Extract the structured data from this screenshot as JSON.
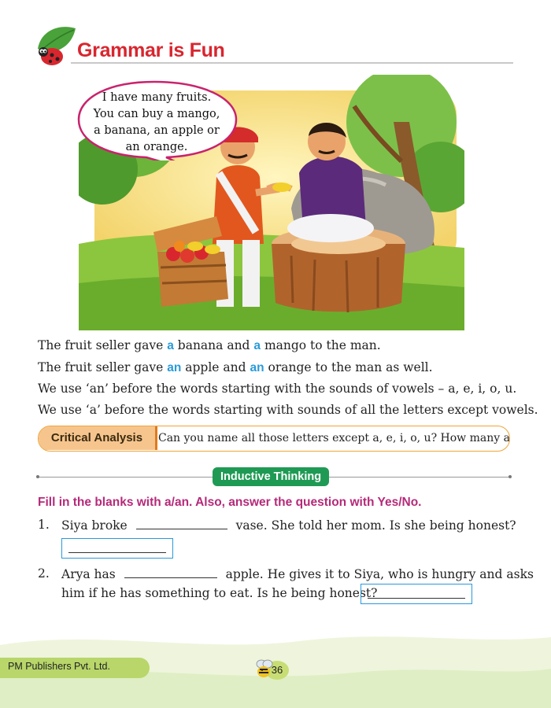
{
  "header": {
    "title": "Grammar is Fun",
    "icon": "ladybug-leaf-icon"
  },
  "speech_bubble": {
    "lines": [
      "I have many fruits.",
      "You can buy a mango,",
      "a banana, an apple or",
      "an orange."
    ]
  },
  "sentences": {
    "s1": {
      "a": "The fruit seller gave ",
      "hl1": "a",
      "b": " banana and ",
      "hl2": "a",
      "c": " mango to the man."
    },
    "s2": {
      "a": "The fruit seller gave ",
      "hl1": "an",
      "b": " apple and ",
      "hl2": "an",
      "c": " orange to the man as well."
    },
    "s3": "We use ‘an’ before the words starting with the sounds of vowels – a, e, i, o, u.",
    "s4": "We use ‘a’ before the words starting with sounds of all the letters except vowels."
  },
  "critical_analysis": {
    "label": "Critical Analysis",
    "question": "Can you name all those letters except a, e, i, o, u? How many are they?"
  },
  "inductive": {
    "badge": "Inductive Thinking",
    "instruction": "Fill in the blanks with a/an. Also, answer the question with Yes/No.",
    "q1": {
      "num": "1.",
      "a": "Siya broke",
      "b": "vase. She told her mom. Is she being honest?"
    },
    "q2": {
      "num": "2.",
      "a": "Arya has",
      "b": "apple. He gives it to Siya, who is hungry and asks",
      "c": "him if he has something to eat. Is he being honest?"
    }
  },
  "footer": {
    "publisher": "PM Publishers Pvt. Ltd.",
    "page": "36"
  },
  "colors": {
    "title": "#d8262f",
    "highlight": "#2a9ad9",
    "instruction": "#b52a79",
    "badge": "#1f9a54",
    "critical_border": "#f0a436"
  }
}
